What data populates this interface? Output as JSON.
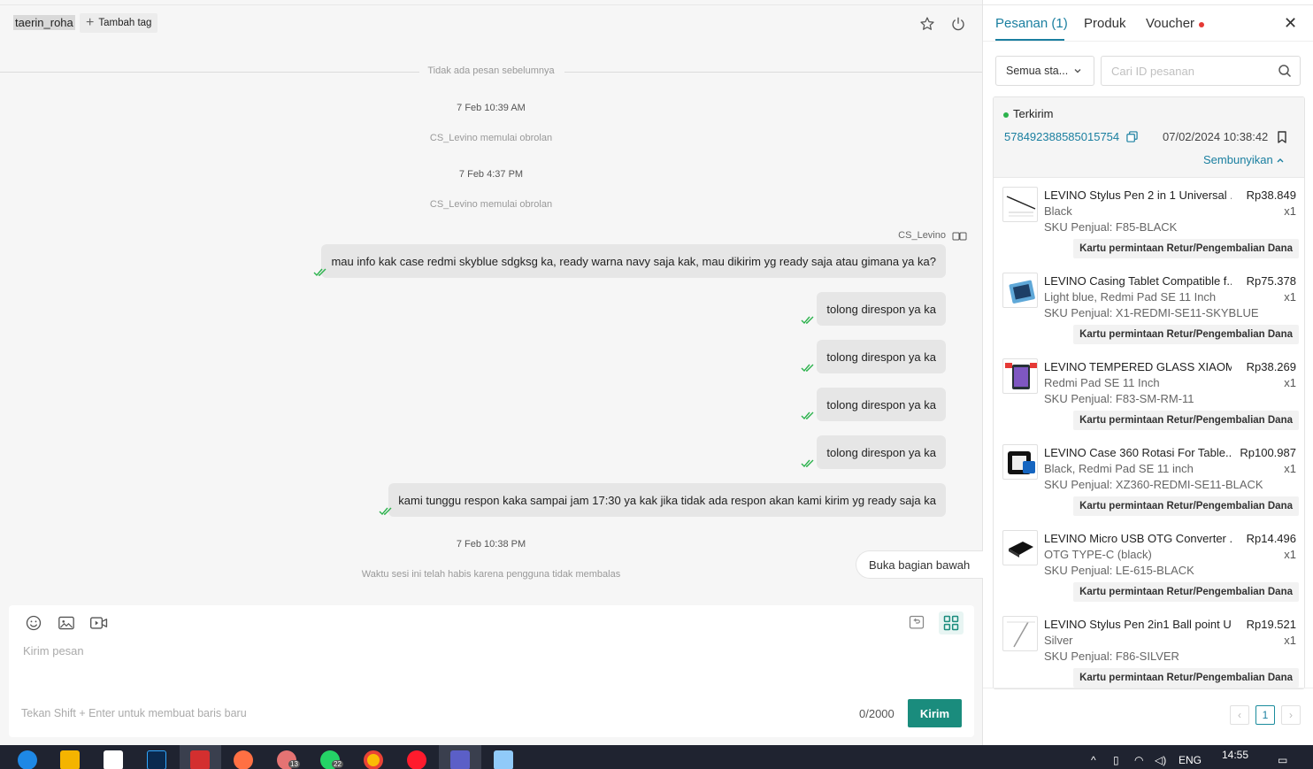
{
  "chat": {
    "username": "taerin_roha",
    "add_tag_label": "Tambah tag",
    "no_prev_messages": "Tidak ada pesan sebelumnya",
    "timeline": [
      {
        "time": "7 Feb 10:39 AM",
        "event": "CS_Levino memulai obrolan"
      },
      {
        "time": "7 Feb 4:37 PM",
        "event": "CS_Levino memulai obrolan"
      }
    ],
    "sender": "CS_Levino",
    "messages": [
      "mau info kak case redmi skyblue sdgksg ka, ready warna navy saja kak, mau dikirim yg ready saja atau gimana ya ka?",
      "tolong direspon ya ka",
      "tolong direspon ya ka",
      "tolong direspon ya ka",
      "tolong direspon ya ka",
      "kami tunggu respon kaka sampai jam 17:30 ya kak jika tidak ada respon akan kami kirim yg ready saja ka"
    ],
    "end_time": "7 Feb 10:38 PM",
    "end_note": "Waktu sesi ini telah habis karena pengguna tidak membalas",
    "jump_bottom_label": "Buka bagian bawah"
  },
  "composer": {
    "placeholder": "Kirim pesan",
    "hint": "Tekan Shift + Enter untuk membuat baris baru",
    "counter": "0/2000",
    "send_label": "Kirim"
  },
  "panel": {
    "tabs": [
      "Pesanan (1)",
      "Produk",
      "Voucher"
    ],
    "status_filter": "Semua sta...",
    "search_placeholder": "Cari ID pesanan",
    "order": {
      "status": "Terkirim",
      "id": "578492388585015754",
      "date": "07/02/2024 10:38:42",
      "hide_label": "Sembunyikan",
      "return_label": "Kartu permintaan Retur/Pengembalian Dana",
      "items": [
        {
          "name": "LEVINO Stylus Pen 2 in 1 Universal ...",
          "price": "Rp38.849",
          "variant": "Black",
          "qty": "x1",
          "sku": "SKU Penjual: F85-BLACK"
        },
        {
          "name": "LEVINO Casing Tablet Compatible f...",
          "price": "Rp75.378",
          "variant": "Light blue, Redmi Pad SE 11 Inch",
          "qty": "x1",
          "sku": "SKU Penjual: X1-REDMI-SE11-SKYBLUE"
        },
        {
          "name": "LEVINO TEMPERED GLASS XIAOMI...",
          "price": "Rp38.269",
          "variant": "Redmi Pad SE 11 Inch",
          "qty": "x1",
          "sku": "SKU Penjual: F83-SM-RM-11"
        },
        {
          "name": "LEVINO Case 360 Rotasi For Table...",
          "price": "Rp100.987",
          "variant": "Black, Redmi Pad SE 11 inch",
          "qty": "x1",
          "sku": "SKU Penjual: XZ360-REDMI-SE11-BLACK"
        },
        {
          "name": "LEVINO Micro USB OTG Converter ...",
          "price": "Rp14.496",
          "variant": "OTG TYPE-C (black)",
          "qty": "x1",
          "sku": "SKU Penjual: LE-615-BLACK"
        },
        {
          "name": "LEVINO Stylus Pen 2in1 Ball point U...",
          "price": "Rp19.521",
          "variant": "Silver",
          "qty": "x1",
          "sku": "SKU Penjual: F86-SILVER"
        }
      ]
    },
    "page": "1"
  },
  "taskbar": {
    "lang": "ENG",
    "time": "14:55",
    "badge_1": "13",
    "badge_2": "22"
  },
  "colors": {
    "accent": "#1a8c7d",
    "link": "#1a7fa0",
    "status_green": "#2bb24c",
    "voucher_dot": "#e53935"
  }
}
